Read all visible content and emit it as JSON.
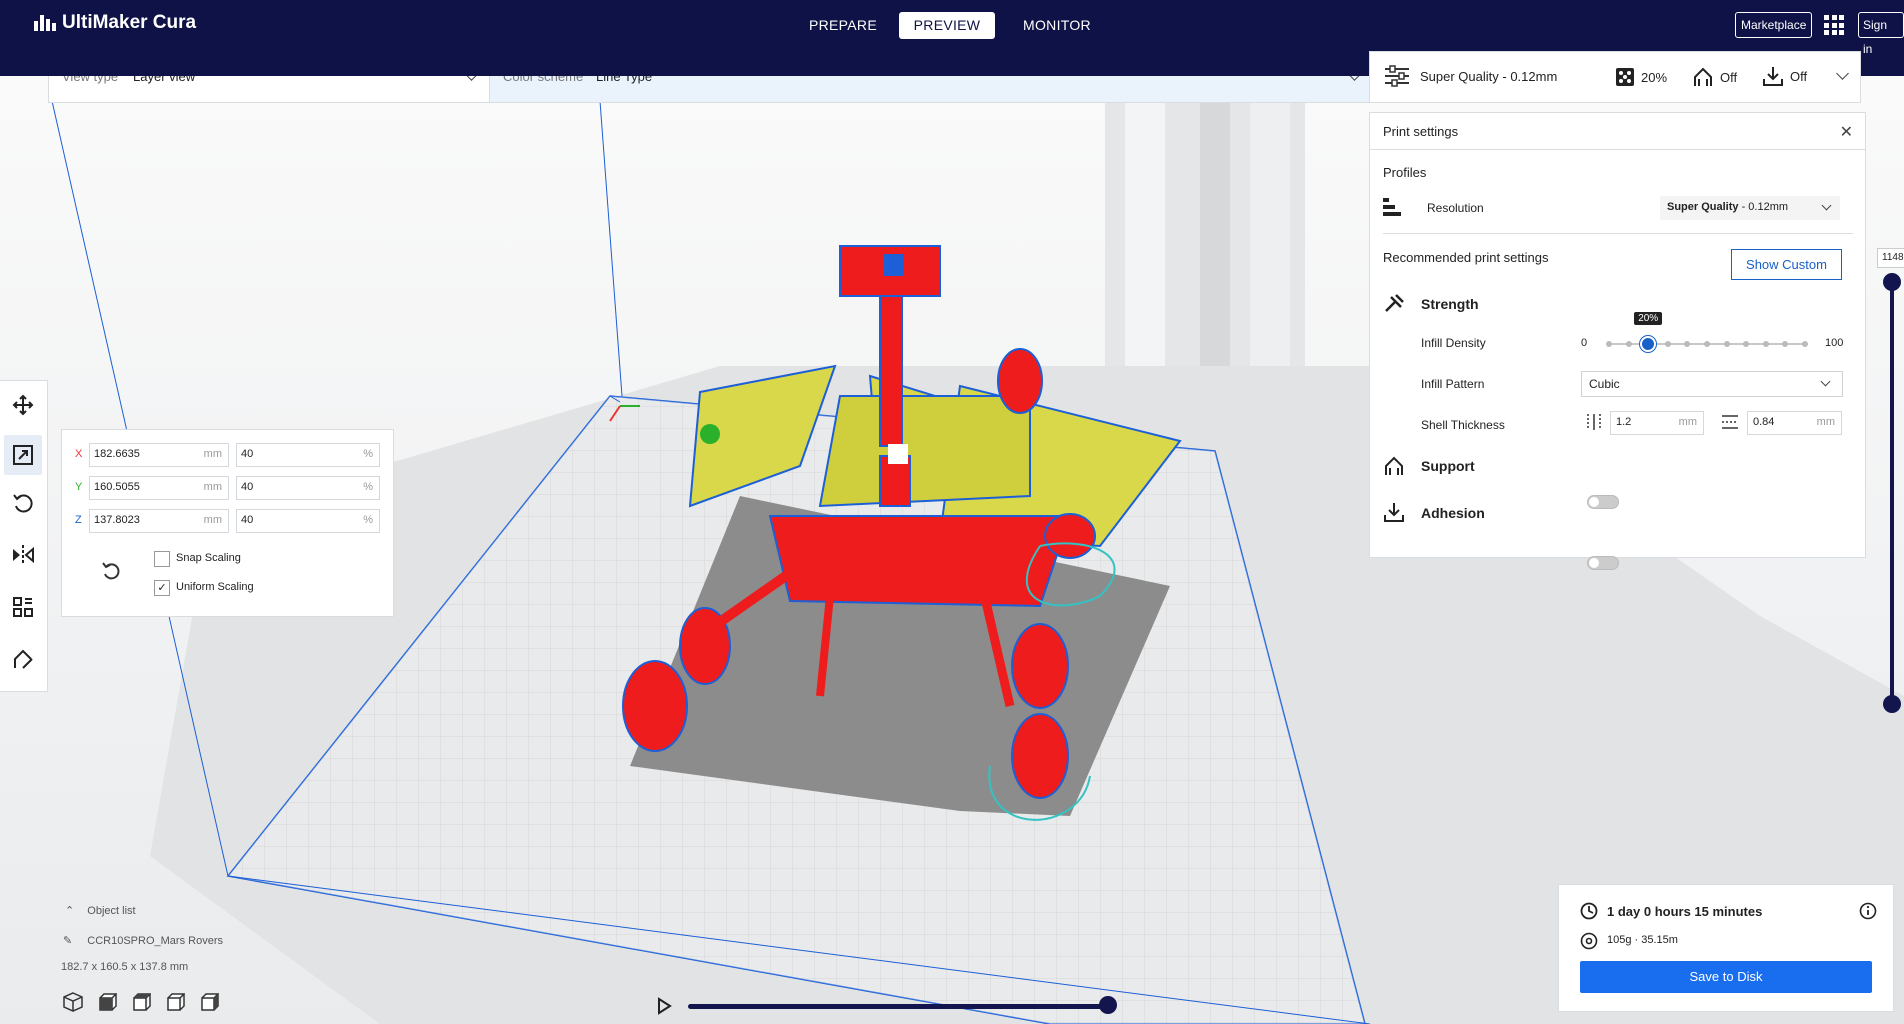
{
  "app": {
    "title": "UltiMaker Cura"
  },
  "nav": {
    "tabs": [
      {
        "label": "PREPARE"
      },
      {
        "label": "PREVIEW"
      },
      {
        "label": "MONITOR"
      }
    ],
    "marketplace": "Marketplace",
    "sign_in": "Sign in"
  },
  "view_bar": {
    "view_type_label": "View type",
    "view_type_value": "Layer view",
    "color_scheme_label": "Color scheme",
    "color_scheme_value": "Line Type"
  },
  "quality_bar": {
    "profile": "Super Quality - 0.12mm",
    "infill": "20%",
    "support": "Off",
    "adhesion": "Off"
  },
  "print_settings": {
    "title": "Print settings",
    "profiles_label": "Profiles",
    "resolution_label": "Resolution",
    "resolution_value_bold": "Super Quality",
    "resolution_value_rest": " - 0.12mm",
    "recommended_label": "Recommended print settings",
    "show_custom": "Show Custom",
    "strength_label": "Strength",
    "infill_density_label": "Infill Density",
    "infill_min": "0",
    "infill_max": "100",
    "infill_value": 20,
    "infill_tooltip": "20%",
    "infill_pattern_label": "Infill Pattern",
    "infill_pattern_value": "Cubic",
    "shell_thickness_label": "Shell Thickness",
    "wall_thickness": "1.2",
    "wall_unit": "mm",
    "top_bottom_thickness": "0.84",
    "top_bottom_unit": "mm",
    "support_label": "Support",
    "adhesion_label": "Adhesion"
  },
  "scale_panel": {
    "x": {
      "axis": "X",
      "value": "182.6635",
      "unit": "mm",
      "percent": "40",
      "pct_unit": "%"
    },
    "y": {
      "axis": "Y",
      "value": "160.5055",
      "unit": "mm",
      "percent": "40",
      "pct_unit": "%"
    },
    "z": {
      "axis": "Z",
      "value": "137.8023",
      "unit": "mm",
      "percent": "40",
      "pct_unit": "%"
    },
    "snap_scaling": "Snap Scaling",
    "uniform_scaling": "Uniform Scaling"
  },
  "object_list": {
    "toggle_label": "Object list",
    "object_name": "CCR10SPRO_Mars Rovers",
    "dimensions": "182.7 x 160.5 x 137.8 mm"
  },
  "layer_slider": {
    "current_layer": "1148"
  },
  "estimate": {
    "print_time": "1 day 0 hours 15 minutes",
    "material": "105g · 35.15m",
    "save_button": "Save to Disk"
  },
  "colors": {
    "topbar": "#0f1246",
    "accent": "#196ef0",
    "model_red": "#ee1c1c",
    "model_yellow": "#d8d84a",
    "outline_blue": "#1c5fd6"
  }
}
